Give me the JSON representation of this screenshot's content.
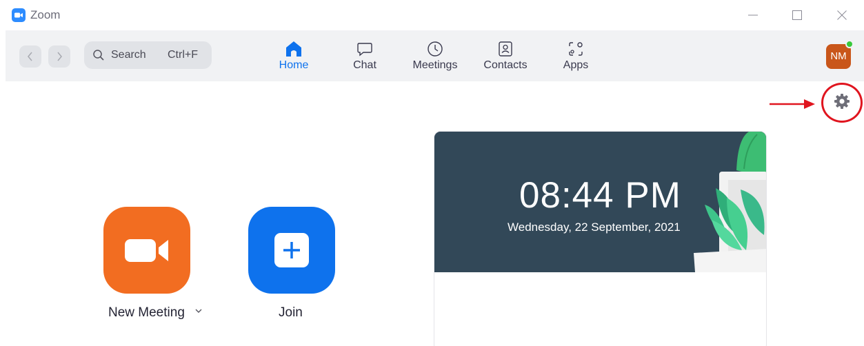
{
  "window": {
    "title": "Zoom",
    "controls": [
      "minimize-icon",
      "maximize-icon",
      "close-icon"
    ]
  },
  "toolbar": {
    "back_icon": "chevron-left-icon",
    "forward_icon": "chevron-right-icon",
    "search": {
      "label": "Search",
      "shortcut": "Ctrl+F",
      "icon": "search-icon"
    },
    "tabs": [
      {
        "label": "Home",
        "icon": "home-icon",
        "selected": true
      },
      {
        "label": "Chat",
        "icon": "chat-bubble-icon",
        "selected": false
      },
      {
        "label": "Meetings",
        "icon": "clock-icon",
        "selected": false
      },
      {
        "label": "Contacts",
        "icon": "contact-card-icon",
        "selected": false
      },
      {
        "label": "Apps",
        "icon": "apps-icon",
        "selected": false
      }
    ],
    "avatar": {
      "initials": "NM",
      "status": "online"
    }
  },
  "settings": {
    "icon": "gear-icon",
    "highlighted": true
  },
  "actions": [
    {
      "label": "New Meeting",
      "icon": "video-camera-icon",
      "color": "#f26d21",
      "has_dropdown": true
    },
    {
      "label": "Join",
      "icon": "plus-icon",
      "color": "#0e72ed",
      "has_dropdown": false
    }
  ],
  "clock": {
    "time": "08:44 PM",
    "date": "Wednesday, 22 September, 2021"
  },
  "colors": {
    "accent": "#0e72ed",
    "new_meeting": "#f26d21",
    "avatar_bg": "#c9561a",
    "status_online": "#37c93a",
    "annotation_red": "#e0151f",
    "card_bg": "#2e4352"
  }
}
